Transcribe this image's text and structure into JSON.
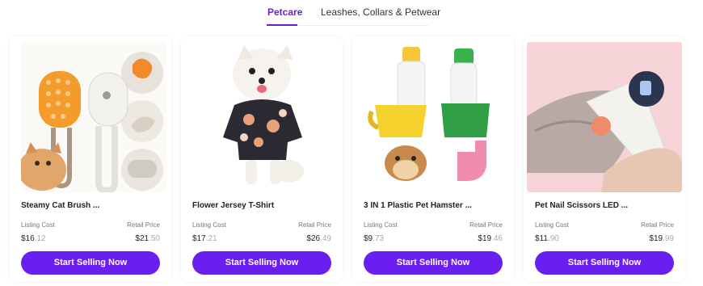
{
  "tabs": [
    {
      "label": "Petcare",
      "active": true
    },
    {
      "label": "Leashes, Collars & Petwear",
      "active": false
    }
  ],
  "colors": {
    "accent": "#6a1ff0",
    "tab_active": "#6a1fd6"
  },
  "products": [
    {
      "name": "Steamy Cat Brush ...",
      "listing_label": "Listing Cost",
      "listing_dollars": "$16",
      "listing_cents": ".12",
      "retail_label": "Retail Price",
      "retail_dollars": "$21",
      "retail_cents": ".50",
      "button": "Start Selling Now",
      "image": "cat-steam-brush-image"
    },
    {
      "name": "Flower Jersey T-Shirt",
      "listing_label": "Listing Cost",
      "listing_dollars": "$17",
      "listing_cents": ".21",
      "retail_label": "Retail Price",
      "retail_dollars": "$26",
      "retail_cents": ".49",
      "button": "Start Selling Now",
      "image": "dog-flower-shirt-image"
    },
    {
      "name": "3 IN 1 Plastic Pet Hamster ...",
      "listing_label": "Listing Cost",
      "listing_dollars": "$9",
      "listing_cents": ".73",
      "retail_label": "Retail Price",
      "retail_dollars": "$19",
      "retail_cents": ".46",
      "button": "Start Selling Now",
      "image": "hamster-water-bottle-image"
    },
    {
      "name": "Pet Nail Scissors LED ...",
      "listing_label": "Listing Cost",
      "listing_dollars": "$11",
      "listing_cents": ".90",
      "retail_label": "Retail Price",
      "retail_dollars": "$19",
      "retail_cents": ".99",
      "button": "Start Selling Now",
      "image": "pet-nail-clipper-image"
    }
  ]
}
